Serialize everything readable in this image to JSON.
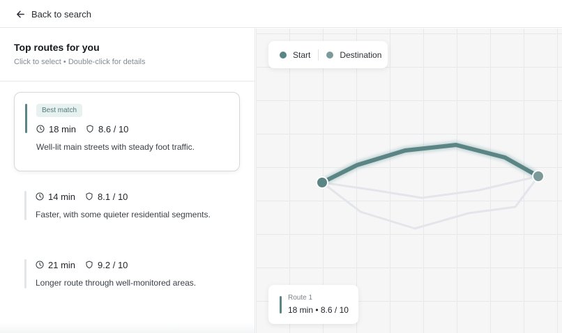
{
  "topbar": {
    "back_label": "Back to search"
  },
  "sidebar": {
    "title": "Top routes for you",
    "subtitle": "Click to select • Double-click for details",
    "routes": [
      {
        "badge": "Best match",
        "duration": "18 min",
        "safety": "8.6 / 10",
        "description": "Well-lit main streets with steady foot traffic.",
        "selected": true
      },
      {
        "badge": "",
        "duration": "14 min",
        "safety": "8.1 / 10",
        "description": "Faster, with some quieter residential segments.",
        "selected": false
      },
      {
        "badge": "",
        "duration": "21 min",
        "safety": "9.2 / 10",
        "description": "Longer route through well-monitored areas.",
        "selected": false
      }
    ]
  },
  "map": {
    "legend": {
      "start": "Start",
      "destination": "Destination"
    },
    "info": {
      "label": "Route 1",
      "value": "18 min • 8.6 / 10"
    },
    "colors": {
      "accent": "#5b8584",
      "start": "#5b8584",
      "destination": "#7c9a9a",
      "alt_route": "#e3e5ea"
    }
  },
  "icons": {
    "back": "arrow-left-icon",
    "duration": "clock-icon",
    "safety": "shield-icon"
  }
}
